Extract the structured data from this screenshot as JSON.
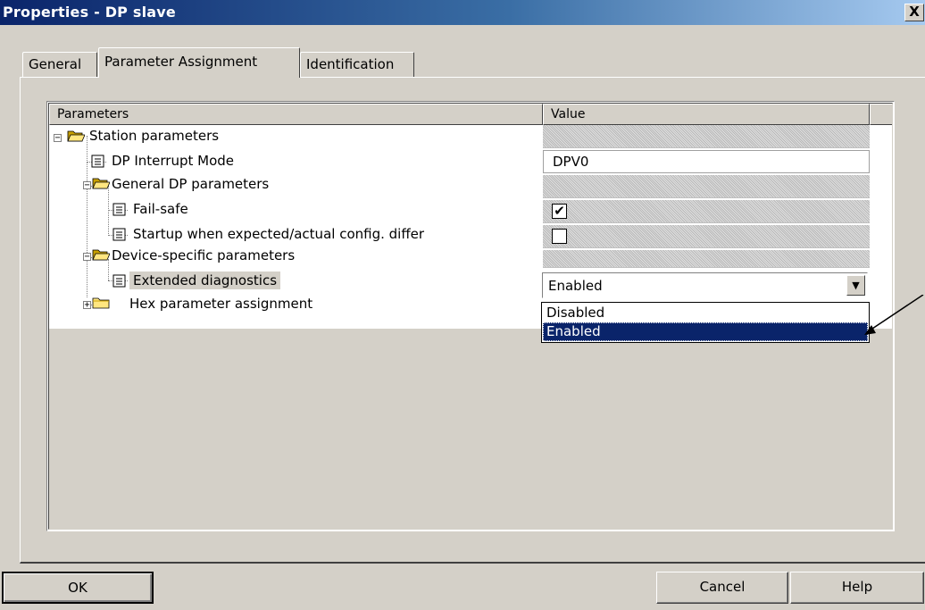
{
  "window": {
    "title": "Properties - DP slave",
    "close_glyph": "X"
  },
  "tabs": [
    {
      "label": "General"
    },
    {
      "label": "Parameter Assignment",
      "active": true
    },
    {
      "label": "Identification"
    }
  ],
  "table": {
    "columns": [
      "Parameters",
      "Value"
    ],
    "rows": [
      {
        "label": "Station parameters",
        "value": "",
        "icon": "open-folder-icon",
        "expander": "−"
      },
      {
        "label": "DP Interrupt Mode",
        "value": "DPV0",
        "icon": "parameter-icon"
      },
      {
        "label": "General DP parameters",
        "value": "",
        "icon": "open-folder-icon",
        "expander": "−"
      },
      {
        "label": "Fail-safe",
        "value": "✔",
        "icon": "parameter-icon"
      },
      {
        "label": "Startup when expected/actual config. differ",
        "value": "",
        "icon": "parameter-icon"
      },
      {
        "label": "Device-specific parameters",
        "value": "",
        "icon": "open-folder-icon",
        "expander": "−"
      },
      {
        "label": "Extended diagnostics",
        "value": "Enabled",
        "icon": "parameter-icon",
        "selected": true
      },
      {
        "label": "Hex parameter assignment",
        "value": "",
        "icon": "closed-folder-icon",
        "expander": "+"
      }
    ]
  },
  "dropdown": {
    "selected": "Enabled",
    "options": [
      "Disabled",
      "Enabled"
    ],
    "highlighted": "Enabled",
    "arrow_glyph": "▼"
  },
  "buttons": {
    "ok": "OK",
    "cancel": "Cancel",
    "help": "Help"
  },
  "colors": {
    "title_bar": "#0a246a",
    "face": "#d4d0c8",
    "selection": "#0a246a"
  }
}
